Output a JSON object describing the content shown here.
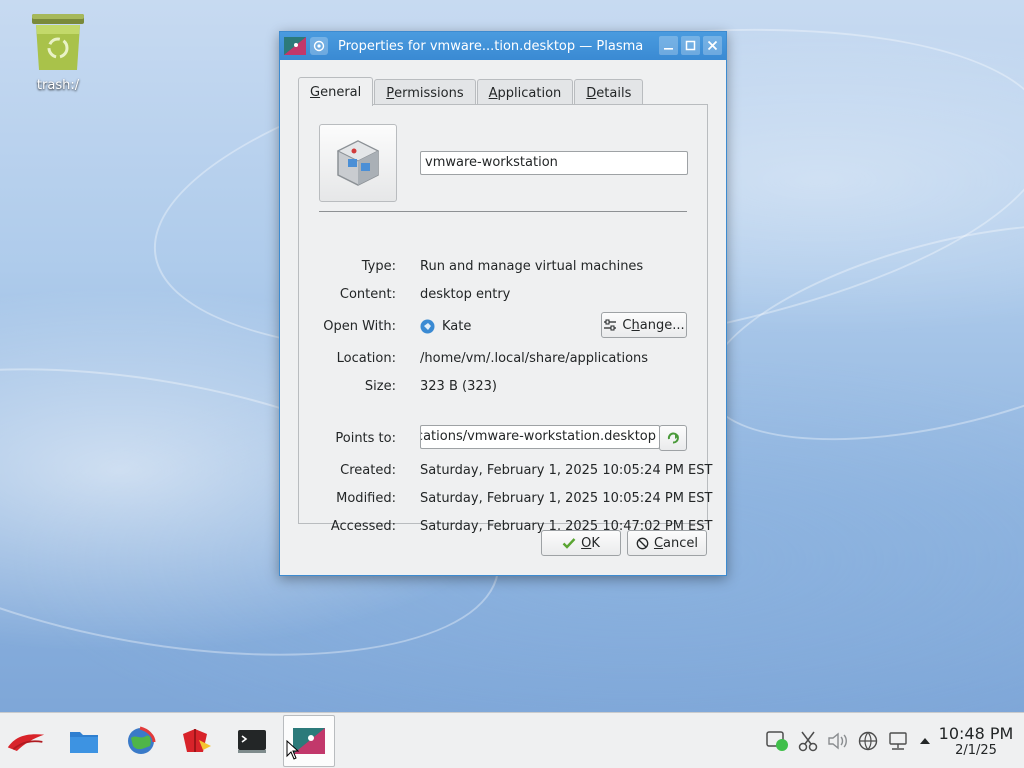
{
  "desktop": {
    "trash_label": "trash:/"
  },
  "window": {
    "title": "Properties for vmware...tion.desktop — Plasma",
    "tabs": [
      {
        "label_prefix": "",
        "label_u": "G",
        "label_suffix": "eneral"
      },
      {
        "label_prefix": "",
        "label_u": "P",
        "label_suffix": "ermissions"
      },
      {
        "label_prefix": "",
        "label_u": "A",
        "label_suffix": "pplication"
      },
      {
        "label_prefix": "",
        "label_u": "D",
        "label_suffix": "etails"
      }
    ],
    "name_value": "vmware-workstation",
    "fields": {
      "type_label": "Type:",
      "type_value": "Run and manage virtual machines",
      "content_label": "Content:",
      "content_value": "desktop entry",
      "open_with_label": "Open With:",
      "open_with_value": "Kate",
      "change_u": "h",
      "change_prefix": "C",
      "change_suffix": "ange...",
      "location_label": "Location:",
      "location_value": "/home/vm/.local/share/applications",
      "size_label": "Size:",
      "size_value": "323 B (323)",
      "points_to_label": "Points to:",
      "points_to_value": "/home/vm/.local/share/applications/vmware-workstation.desktop",
      "created_label": "Created:",
      "created_value": "Saturday, February 1, 2025 10:05:24 PM EST",
      "modified_label": "Modified:",
      "modified_value": "Saturday, February 1, 2025 10:05:24 PM EST",
      "accessed_label": "Accessed:",
      "accessed_value": "Saturday, February 1, 2025 10:47:02 PM EST"
    },
    "ok_u": "O",
    "ok_suffix": "K",
    "cancel_u": "C",
    "cancel_suffix": "ancel"
  },
  "taskbar": {
    "clock_time": "10:48 PM",
    "clock_date": "2/1/25"
  },
  "colors": {
    "titlebar": "#3a8ad3",
    "ok_check": "#5aa532"
  }
}
